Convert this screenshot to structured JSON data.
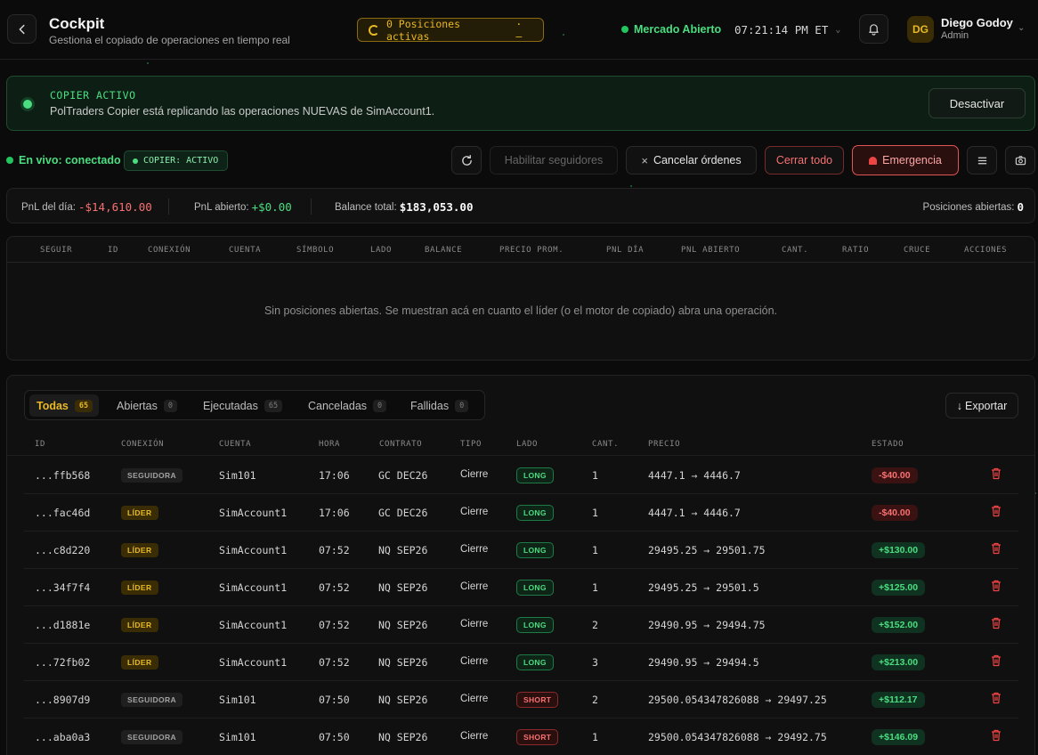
{
  "header": {
    "title": "Cockpit",
    "subtitle": "Gestiona el copiado de operaciones en tiempo real",
    "positions_badge": "0 Posiciones activas",
    "positions_badge_suffix": "· —",
    "market_status": "Mercado Abierto",
    "clock": "07:21:14 PM ET",
    "user": {
      "initials": "DG",
      "name": "Diego Godoy",
      "role": "Admin"
    }
  },
  "banner": {
    "title": "COPIER ACTIVO",
    "text": "PolTraders Copier está replicando las operaciones NUEVAS de SimAccount1.",
    "button": "Desactivar"
  },
  "status": {
    "live": "En vivo: conectado",
    "copier": "COPIER: ACTIVO"
  },
  "toolbar": {
    "enable_followers": "Habilitar seguidores",
    "cancel_orders": "Cancelar órdenes",
    "close_all": "Cerrar todo",
    "emergency": "Emergencia"
  },
  "pnl": {
    "day_label": "PnL del día:",
    "day_value": "-$14,610.00",
    "open_label": "PnL abierto:",
    "open_value": "+$0.00",
    "balance_label": "Balance total:",
    "balance_value": "$183,053.00",
    "open_positions_label": "Posiciones abiertas:",
    "open_positions_value": "0"
  },
  "positions_table": {
    "headers": [
      "SEGUIR",
      "ID",
      "CONEXIÓN",
      "CUENTA",
      "SÍMBOLO",
      "LADO",
      "BALANCE",
      "PRECIO PROM.",
      "PNL DÍA",
      "PNL ABIERTO",
      "CANT.",
      "RATIO",
      "CRUCE",
      "ACCIONES"
    ],
    "empty_message": "Sin posiciones abiertas. Se muestran acá en cuanto el líder (o el motor de copiado) abra una operación."
  },
  "orders": {
    "tabs": [
      {
        "label": "Todas",
        "count": "65"
      },
      {
        "label": "Abiertas",
        "count": "0"
      },
      {
        "label": "Ejecutadas",
        "count": "65"
      },
      {
        "label": "Canceladas",
        "count": "0"
      },
      {
        "label": "Fallidas",
        "count": "0"
      }
    ],
    "export": "Exportar",
    "headers": [
      "ID",
      "CONEXIÓN",
      "CUENTA",
      "HORA",
      "CONTRATO",
      "TIPO",
      "LADO",
      "CANT.",
      "PRECIO",
      "ESTADO"
    ],
    "rows": [
      {
        "id": "...ffb568",
        "conexion": "SEGUIDORA",
        "cuenta": "Sim101",
        "hora": "17:06",
        "contrato": "GC DEC26",
        "tipo": "Cierre",
        "lado": "LONG",
        "cant": "1",
        "precio": "4447.1 → 4446.7",
        "estado": "-$40.00"
      },
      {
        "id": "...fac46d",
        "conexion": "LÍDER",
        "cuenta": "SimAccount1",
        "hora": "17:06",
        "contrato": "GC DEC26",
        "tipo": "Cierre",
        "lado": "LONG",
        "cant": "1",
        "precio": "4447.1 → 4446.7",
        "estado": "-$40.00"
      },
      {
        "id": "...c8d220",
        "conexion": "LÍDER",
        "cuenta": "SimAccount1",
        "hora": "07:52",
        "contrato": "NQ SEP26",
        "tipo": "Cierre",
        "lado": "LONG",
        "cant": "1",
        "precio": "29495.25 → 29501.75",
        "estado": "+$130.00"
      },
      {
        "id": "...34f7f4",
        "conexion": "LÍDER",
        "cuenta": "SimAccount1",
        "hora": "07:52",
        "contrato": "NQ SEP26",
        "tipo": "Cierre",
        "lado": "LONG",
        "cant": "1",
        "precio": "29495.25 → 29501.5",
        "estado": "+$125.00"
      },
      {
        "id": "...d1881e",
        "conexion": "LÍDER",
        "cuenta": "SimAccount1",
        "hora": "07:52",
        "contrato": "NQ SEP26",
        "tipo": "Cierre",
        "lado": "LONG",
        "cant": "2",
        "precio": "29490.95 → 29494.75",
        "estado": "+$152.00"
      },
      {
        "id": "...72fb02",
        "conexion": "LÍDER",
        "cuenta": "SimAccount1",
        "hora": "07:52",
        "contrato": "NQ SEP26",
        "tipo": "Cierre",
        "lado": "LONG",
        "cant": "3",
        "precio": "29490.95 → 29494.5",
        "estado": "+$213.00"
      },
      {
        "id": "...8907d9",
        "conexion": "SEGUIDORA",
        "cuenta": "Sim101",
        "hora": "07:50",
        "contrato": "NQ SEP26",
        "tipo": "Cierre",
        "lado": "SHORT",
        "cant": "2",
        "precio": "29500.054347826088 → 29497.25",
        "estado": "+$112.17"
      },
      {
        "id": "...aba0a3",
        "conexion": "SEGUIDORA",
        "cuenta": "Sim101",
        "hora": "07:50",
        "contrato": "NQ SEP26",
        "tipo": "Cierre",
        "lado": "SHORT",
        "cant": "1",
        "precio": "29500.054347826088 → 29492.75",
        "estado": "+$146.09"
      }
    ]
  },
  "colors": {
    "accent": "#e8b923",
    "positive": "#4ade80",
    "negative": "#f87171",
    "background": "#0b0b0b"
  }
}
